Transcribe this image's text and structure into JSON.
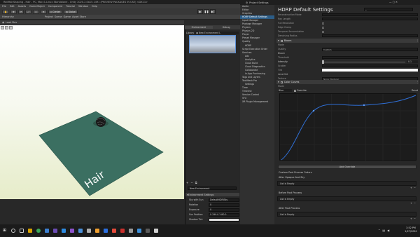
{
  "unity": {
    "title": "RedHairShaping - Hair - PC, Mac & Linux Standalone - Unity 2020.2.0a15.1491 (PREVIEW PACKAGES IN USE) <DX11>",
    "menu": [
      "File",
      "Edit",
      "Assets",
      "GameObject",
      "Component",
      "Tutorial",
      "Window",
      "Help"
    ],
    "toolbar": {
      "center": "Center",
      "global": "Global"
    },
    "hierarchy_tabs": [
      "Hierarchy",
      "Project",
      "Scene",
      "Game",
      "Asset Store"
    ],
    "scene_tab": "Look Dev",
    "viewport_label": "Hair"
  },
  "environment": {
    "tabs": [
      "Environment",
      "Debug"
    ],
    "library_label": "Library",
    "library_value": "New Environment L",
    "name_field": "New Environment",
    "settings_header": "Environment Settings",
    "rows": [
      {
        "label": "Sky with Sun",
        "value": "DefaultHDRISky"
      },
      {
        "label": "Rotation",
        "value": "0"
      },
      {
        "label": "Exposure",
        "value": "0"
      },
      {
        "label": "Sun Position",
        "value": "X 299.0  Y 80.0"
      },
      {
        "label": "Shadow Tint",
        "value": ""
      }
    ]
  },
  "project_settings": {
    "title": "Project Settings",
    "nav": [
      {
        "label": "Audio"
      },
      {
        "label": "Editor"
      },
      {
        "label": "Graphics"
      },
      {
        "label": "HDRP Default Settings",
        "selected": true
      },
      {
        "label": "Input Manager"
      },
      {
        "label": "Package Manager"
      },
      {
        "label": "Physics"
      },
      {
        "label": "Physics 2D"
      },
      {
        "label": "Player"
      },
      {
        "label": "Preset Manager"
      },
      {
        "label": "Quality"
      },
      {
        "label": "HDRP",
        "sub": true
      },
      {
        "label": "Script Execution Order"
      },
      {
        "label": "Services"
      },
      {
        "label": "Ads",
        "sub": true
      },
      {
        "label": "Analytics",
        "sub": true
      },
      {
        "label": "Cloud Build",
        "sub": true
      },
      {
        "label": "Cloud Diagnostics",
        "sub": true
      },
      {
        "label": "Collaborate",
        "sub": true
      },
      {
        "label": "In-App Purchasing",
        "sub": true
      },
      {
        "label": "Tags and Layers"
      },
      {
        "label": "TextMesh Pro"
      },
      {
        "label": "Settings",
        "sub": true
      },
      {
        "label": "Time"
      },
      {
        "label": "Timeline"
      },
      {
        "label": "Version Control"
      },
      {
        "label": "VFX"
      },
      {
        "label": "XR Plugin Management"
      }
    ],
    "heading": "HDRP Default Settings",
    "top_rows": [
      "Reconstruction Mode",
      "Ray Length",
      "Full Resolution",
      "Edge Clamp",
      "Temporal Accumulation",
      "Denoising Radius"
    ],
    "bloom": {
      "header": "Bloom",
      "mode": "Mode",
      "quality_label": "Quality",
      "quality_value": "Custom",
      "subheader": "Bloom",
      "threshold": "Threshold",
      "intensity_label": "Intensity",
      "intensity_value": "0.1",
      "scatter": "Scatter",
      "tint": "Tint",
      "lens_dirt": "Lens Dirt",
      "texture": "Texture",
      "texture_value": "None (Texture)",
      "dirt_intensity": "Intensity"
    },
    "color_curves": {
      "header": "Color Curves",
      "mode": "Mode",
      "channel": "Blue",
      "override": "Override",
      "reset": "Reset"
    },
    "add_override": "Add Override",
    "custom_pp_title": "Custom Post Process Orders",
    "cpp_sections": [
      {
        "header": "After Opaque And Sky",
        "list": "List is Empty"
      },
      {
        "header": "Before Post Process",
        "list": "List is Empty"
      },
      {
        "header": "After Post Process",
        "list": "List is Empty"
      }
    ]
  },
  "taskbar": {
    "time": "3:52 PM",
    "date": "1/27/2020"
  }
}
